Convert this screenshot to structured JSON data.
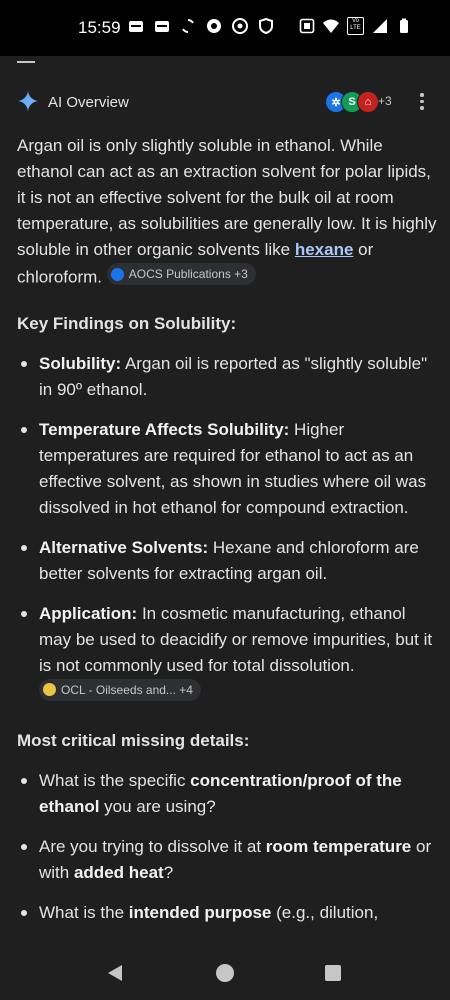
{
  "status_bar": {
    "time": "15:59",
    "left_icons": [
      "mail-icon",
      "mail-icon",
      "sync-icon",
      "record-icon",
      "chrome-icon",
      "shield-icon"
    ],
    "right_icons": [
      "nfc-icon",
      "wifi-icon",
      "volte-icon",
      "signal-icon",
      "battery-icon"
    ],
    "volte_text": "Vo LTE"
  },
  "header": {
    "title": "AI Overview",
    "sources_count": "+3",
    "avatar_colors": [
      "#1a73e8",
      "#0f9d58",
      "#c5221f"
    ]
  },
  "intro": {
    "text_before_link": "Argan oil is only slightly soluble in ethanol. While ethanol can act as an extraction solvent for polar lipids, it is not an effective solvent for the bulk oil at room temperature, as solubilities are generally low. It is highly soluble in other organic solvents like ",
    "link_text": "hexane",
    "text_after_link": " or chloroform.",
    "citation_chip": "AOCS Publications +3"
  },
  "key_findings": {
    "heading": "Key Findings on Solubility:",
    "items": [
      {
        "label": "Solubility:",
        "text": " Argan oil is reported as \"slightly soluble\" in 90º ethanol."
      },
      {
        "label": "Temperature Affects Solubility:",
        "text": " Higher temperatures are required for ethanol to act as an effective solvent, as shown in studies where oil was dissolved in hot ethanol for compound extraction."
      },
      {
        "label": "Alternative Solvents:",
        "text": " Hexane and chloroform are better solvents for extracting argan oil."
      },
      {
        "label": "Application:",
        "text": " In cosmetic manufacturing, ethanol may be used to deacidify or remove impurities, but it is not commonly used for total dissolution.",
        "chip": "OCL - Oilseeds and... +4"
      }
    ]
  },
  "missing_details": {
    "heading": "Most critical missing details:",
    "q1": {
      "a": "What is the specific ",
      "b": "concentration/proof of the ethanol",
      "c": " you are using?"
    },
    "q2": {
      "a": "Are you trying to dissolve it at ",
      "b": "room temperature",
      "c": " or with ",
      "d": "added heat",
      "e": "?"
    },
    "q3": {
      "a": "What is the ",
      "b": "intended purpose",
      "c": " (e.g., dilution,"
    }
  }
}
